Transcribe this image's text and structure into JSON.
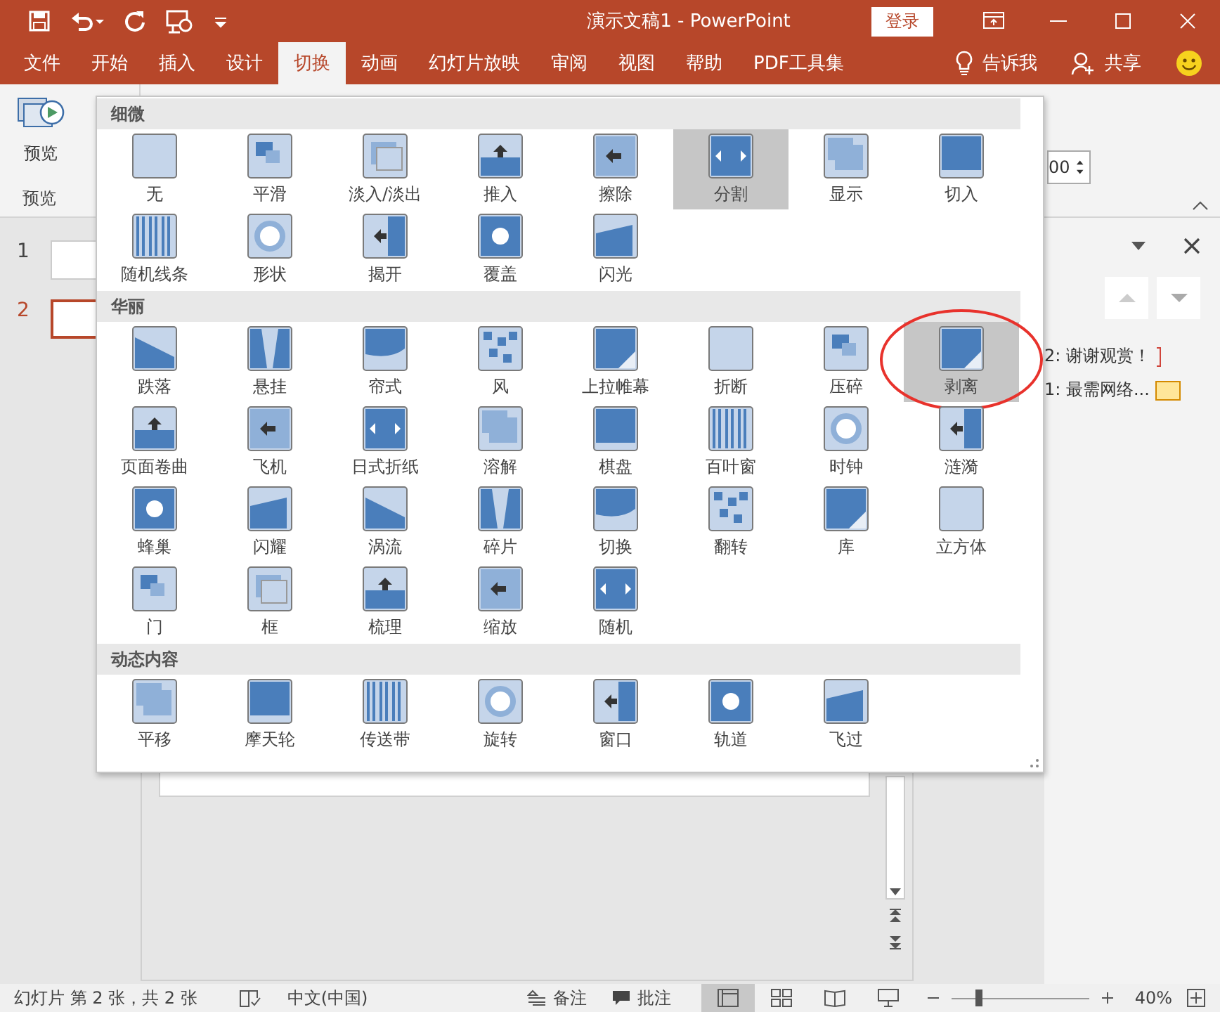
{
  "title_bar": {
    "title": "演示文稿1  -  PowerPoint",
    "sign_in": "登录"
  },
  "ribbon_tabs": [
    {
      "label": "文件",
      "selected": false
    },
    {
      "label": "开始",
      "selected": false
    },
    {
      "label": "插入",
      "selected": false
    },
    {
      "label": "设计",
      "selected": false
    },
    {
      "label": "切换",
      "selected": true
    },
    {
      "label": "动画",
      "selected": false
    },
    {
      "label": "幻灯片放映",
      "selected": false
    },
    {
      "label": "审阅",
      "selected": false
    },
    {
      "label": "视图",
      "selected": false
    },
    {
      "label": "帮助",
      "selected": false
    },
    {
      "label": "PDF工具集",
      "selected": false
    }
  ],
  "tell_me": "告诉我",
  "share": "共享",
  "ribbon": {
    "preview_button": "预览",
    "group_label": "预览",
    "spin_value": "00"
  },
  "thumbnails": [
    {
      "number": "1",
      "selected": false
    },
    {
      "number": "2",
      "selected": true
    }
  ],
  "gallery": {
    "sections": [
      {
        "title": "细微",
        "items": [
          {
            "label": "无",
            "selected": false,
            "circled": false
          },
          {
            "label": "平滑",
            "selected": false,
            "circled": false
          },
          {
            "label": "淡入/淡出",
            "selected": false,
            "circled": false
          },
          {
            "label": "推入",
            "selected": false,
            "circled": false
          },
          {
            "label": "擦除",
            "selected": false,
            "circled": false
          },
          {
            "label": "分割",
            "selected": true,
            "circled": false
          },
          {
            "label": "显示",
            "selected": false,
            "circled": false
          },
          {
            "label": "切入",
            "selected": false,
            "circled": false
          },
          {
            "label": "随机线条",
            "selected": false,
            "circled": false
          },
          {
            "label": "形状",
            "selected": false,
            "circled": false
          },
          {
            "label": "揭开",
            "selected": false,
            "circled": false
          },
          {
            "label": "覆盖",
            "selected": false,
            "circled": false
          },
          {
            "label": "闪光",
            "selected": false,
            "circled": false
          }
        ]
      },
      {
        "title": "华丽",
        "items": [
          {
            "label": "跌落",
            "selected": false,
            "circled": false
          },
          {
            "label": "悬挂",
            "selected": false,
            "circled": false
          },
          {
            "label": "帘式",
            "selected": false,
            "circled": false
          },
          {
            "label": "风",
            "selected": false,
            "circled": false
          },
          {
            "label": "上拉帷幕",
            "selected": false,
            "circled": false
          },
          {
            "label": "折断",
            "selected": false,
            "circled": false
          },
          {
            "label": "压碎",
            "selected": false,
            "circled": false
          },
          {
            "label": "剥离",
            "selected": true,
            "circled": true
          },
          {
            "label": "页面卷曲",
            "selected": false,
            "circled": false
          },
          {
            "label": "飞机",
            "selected": false,
            "circled": false
          },
          {
            "label": "日式折纸",
            "selected": false,
            "circled": false
          },
          {
            "label": "溶解",
            "selected": false,
            "circled": false
          },
          {
            "label": "棋盘",
            "selected": false,
            "circled": false
          },
          {
            "label": "百叶窗",
            "selected": false,
            "circled": false
          },
          {
            "label": "时钟",
            "selected": false,
            "circled": false
          },
          {
            "label": "涟漪",
            "selected": false,
            "circled": false
          },
          {
            "label": "蜂巢",
            "selected": false,
            "circled": false
          },
          {
            "label": "闪耀",
            "selected": false,
            "circled": false
          },
          {
            "label": "涡流",
            "selected": false,
            "circled": false
          },
          {
            "label": "碎片",
            "selected": false,
            "circled": false
          },
          {
            "label": "切换",
            "selected": false,
            "circled": false
          },
          {
            "label": "翻转",
            "selected": false,
            "circled": false
          },
          {
            "label": "库",
            "selected": false,
            "circled": false
          },
          {
            "label": "立方体",
            "selected": false,
            "circled": false
          },
          {
            "label": "门",
            "selected": false,
            "circled": false
          },
          {
            "label": "框",
            "selected": false,
            "circled": false
          },
          {
            "label": "梳理",
            "selected": false,
            "circled": false
          },
          {
            "label": "缩放",
            "selected": false,
            "circled": false
          },
          {
            "label": "随机",
            "selected": false,
            "circled": false
          }
        ]
      },
      {
        "title": "动态内容",
        "items": [
          {
            "label": "平移",
            "selected": false,
            "circled": false
          },
          {
            "label": "摩天轮",
            "selected": false,
            "circled": false
          },
          {
            "label": "传送带",
            "selected": false,
            "circled": false
          },
          {
            "label": "旋转",
            "selected": false,
            "circled": false
          },
          {
            "label": "窗口",
            "selected": false,
            "circled": false
          },
          {
            "label": "轨道",
            "selected": false,
            "circled": false
          },
          {
            "label": "飞过",
            "selected": false,
            "circled": false
          }
        ]
      }
    ]
  },
  "right_panel": {
    "entries": [
      {
        "label": "2: 谢谢观赏！",
        "kind": "bracket",
        "color": "#d0443a"
      },
      {
        "label": "1: 最需网络...",
        "kind": "swatch",
        "color": "#ffe699"
      }
    ]
  },
  "status_bar": {
    "slide_info": "幻灯片 第 2 张，共 2 张",
    "language": "中文(中国)",
    "notes": "备注",
    "comments": "批注",
    "view_buttons": [
      {
        "selected": true
      },
      {
        "selected": false
      },
      {
        "selected": false
      },
      {
        "selected": false
      }
    ],
    "zoom": {
      "level": 0.17
    },
    "zoom_text": "40%"
  }
}
